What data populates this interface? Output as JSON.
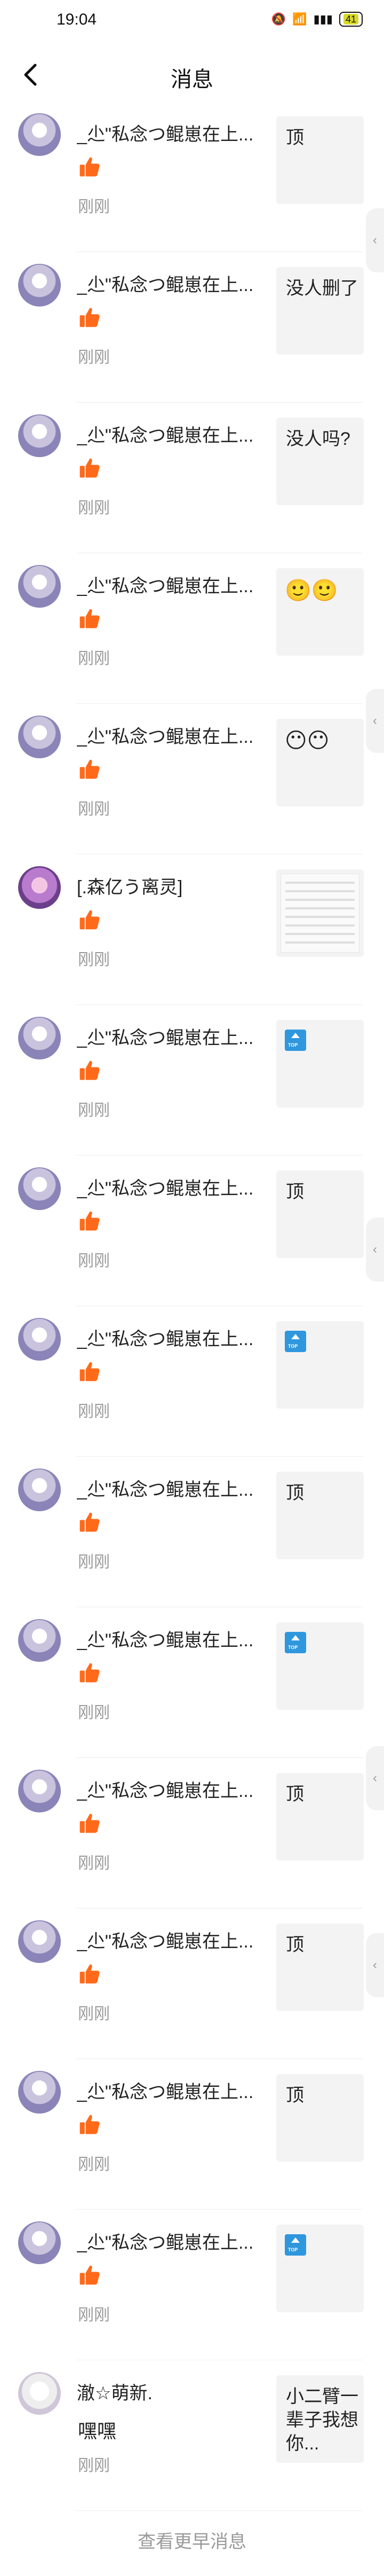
{
  "status": {
    "time": "19:04",
    "battery": "41"
  },
  "nav": {
    "title": "消息"
  },
  "messages": [
    {
      "name": "_尐\"私念つ鲲崽在上...",
      "time": "刚刚",
      "preview": {
        "type": "text",
        "text": "顶"
      }
    },
    {
      "name": "_尐\"私念つ鲲崽在上...",
      "time": "刚刚",
      "preview": {
        "type": "text",
        "text": "没人删了"
      }
    },
    {
      "name": "_尐\"私念つ鲲崽在上...",
      "time": "刚刚",
      "preview": {
        "type": "text",
        "text": "没人吗?"
      }
    },
    {
      "name": "_尐\"私念つ鲲崽在上...",
      "time": "刚刚",
      "preview": {
        "type": "emoji",
        "text": "🙂🙂"
      }
    },
    {
      "name": "_尐\"私念つ鲲崽在上...",
      "time": "刚刚",
      "preview": {
        "type": "emoji",
        "text": "😶😶"
      }
    },
    {
      "name": "[.森亿う离灵]",
      "time": "刚刚",
      "preview": {
        "type": "screenshot"
      }
    },
    {
      "name": "_尐\"私念つ鲲崽在上...",
      "time": "刚刚",
      "preview": {
        "type": "top"
      }
    },
    {
      "name": "_尐\"私念つ鲲崽在上...",
      "time": "刚刚",
      "preview": {
        "type": "text",
        "text": "顶"
      }
    },
    {
      "name": "_尐\"私念つ鲲崽在上...",
      "time": "刚刚",
      "preview": {
        "type": "top"
      }
    },
    {
      "name": "_尐\"私念つ鲲崽在上...",
      "time": "刚刚",
      "preview": {
        "type": "text",
        "text": "顶"
      }
    },
    {
      "name": "_尐\"私念つ鲲崽在上...",
      "time": "刚刚",
      "preview": {
        "type": "top"
      }
    },
    {
      "name": "_尐\"私念つ鲲崽在上...",
      "time": "刚刚",
      "preview": {
        "type": "text",
        "text": "顶"
      }
    },
    {
      "name": "_尐\"私念つ鲲崽在上...",
      "time": "刚刚",
      "preview": {
        "type": "text",
        "text": "顶"
      }
    },
    {
      "name": "_尐\"私念つ鲲崽在上...",
      "time": "刚刚",
      "preview": {
        "type": "text",
        "text": "顶"
      }
    },
    {
      "name": "_尐\"私念つ鲲崽在上...",
      "time": "刚刚",
      "preview": {
        "type": "top"
      }
    },
    {
      "name": "澈☆萌新.",
      "time": "刚刚",
      "body": "嘿嘿",
      "preview": {
        "type": "text",
        "text": "小二臂一辈子我想你..."
      }
    }
  ],
  "footer": {
    "load_more": "查看更早消息"
  },
  "colors": {
    "accent": "#ff6a1a",
    "muted": "#9a9a9a",
    "divider": "#eeeeee"
  }
}
